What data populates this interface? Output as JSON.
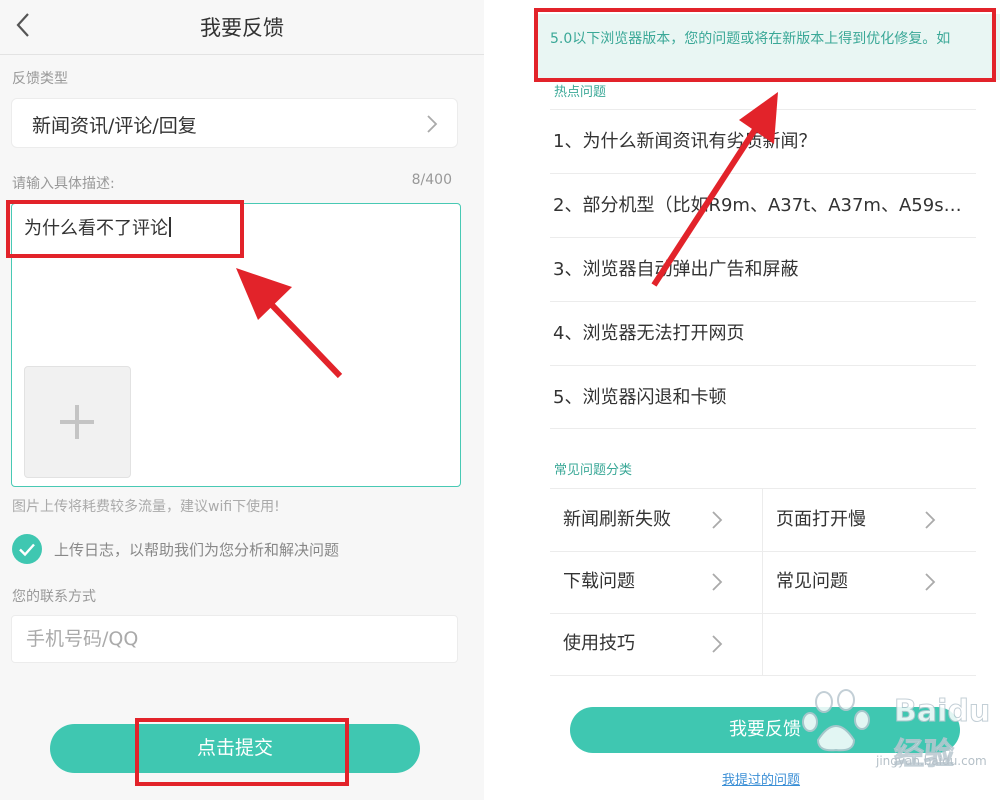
{
  "colors": {
    "accent": "#3fc7b1",
    "annotation_red": "#e2232a",
    "banner_bg": "#e9f6f3",
    "link": "#3b8fd6"
  },
  "left": {
    "header": {
      "title": "我要反馈",
      "back_icon": "back-arrow-icon"
    },
    "feedback_type_label": "反馈类型",
    "feedback_type_value": "新闻资讯/评论/回复",
    "description_label": "请输入具体描述:",
    "char_counter": "8/400",
    "description_text": "为什么看不了评论",
    "add_image_icon": "plus-icon",
    "upload_warning": "图片上传将耗费较多流量，建议wifi下使用!",
    "upload_log_label": "上传日志，以帮助我们为您分析和解决问题",
    "upload_log_checked": true,
    "contact_label": "您的联系方式",
    "contact_placeholder": "手机号码/QQ",
    "submit_label": "点击提交"
  },
  "right": {
    "banner_text": "5.0以下浏览器版本，您的问题或将在新版本上得到优化修复。如",
    "hot_section_title": "热点问题",
    "hot_questions": [
      "1、为什么新闻资讯有劣质新闻？",
      "2、部分机型（比如R9m、A37t、A37m、A59s…",
      "3、浏览器自动弹出广告和屏蔽",
      "4、浏览器无法打开网页",
      "5、浏览器闪退和卡顿"
    ],
    "category_section_title": "常见问题分类",
    "categories": [
      "新闻刷新失败",
      "页面打开慢",
      "下载问题",
      "常见问题",
      "使用技巧"
    ],
    "feedback_button": "我要反馈",
    "history_link": "我提过的问题",
    "watermark": {
      "brand": "Baidu经验",
      "url": "jingyan.baidu.com"
    }
  }
}
